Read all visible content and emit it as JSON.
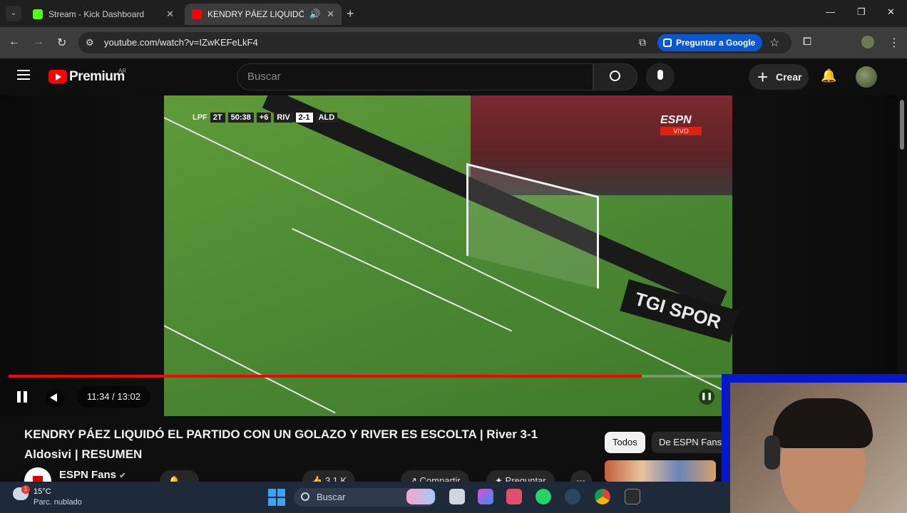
{
  "browser": {
    "tabs": [
      {
        "title": "Stream - Kick Dashboard",
        "icon": "kick-icon",
        "active": false
      },
      {
        "title": "KENDRY PÁEZ LIQUIDÓ EL P",
        "icon": "youtube-icon",
        "active": true
      }
    ],
    "url": "youtube.com/watch?v=IZwKEFeLkF4",
    "google_button": "Preguntar a Google"
  },
  "youtube": {
    "brand": "Premium",
    "country": "AR",
    "search_placeholder": "Buscar",
    "create_label": "Crear",
    "video": {
      "current_time": "11:34",
      "duration": "13:02",
      "time_display": "11:34 / 13:02",
      "progress_percent": 88.8,
      "scorebug": {
        "league": "LPF",
        "half": "2T",
        "clock": "50:38",
        "added": "+6",
        "home": "RIV",
        "score": "2-1",
        "away": "ALD"
      },
      "broadcaster": "ESPN",
      "live_label": "VIVO",
      "ad_board": "TGI SPOR"
    },
    "title_line1": "KENDRY PÁEZ LIQUIDÓ EL PARTIDO CON UN GOLAZO Y RIVER ES ESCOLTA | River 3-1",
    "title_line2": "Aldosivi | RESUMEN",
    "channel": "ESPN Fans",
    "actions": {
      "like": "3,1 K",
      "share": "Compartir",
      "ask": "Preguntar"
    },
    "chips": [
      "Todos",
      "De ESPN Fans"
    ]
  },
  "taskbar": {
    "temperature": "15°C",
    "condition": "Parc. nublado",
    "weather_badge": "1",
    "search_label": "Buscar"
  },
  "colors": {
    "accent": "#ff0000",
    "google_blue": "#0b57d0",
    "cam_border": "#0818c8"
  }
}
